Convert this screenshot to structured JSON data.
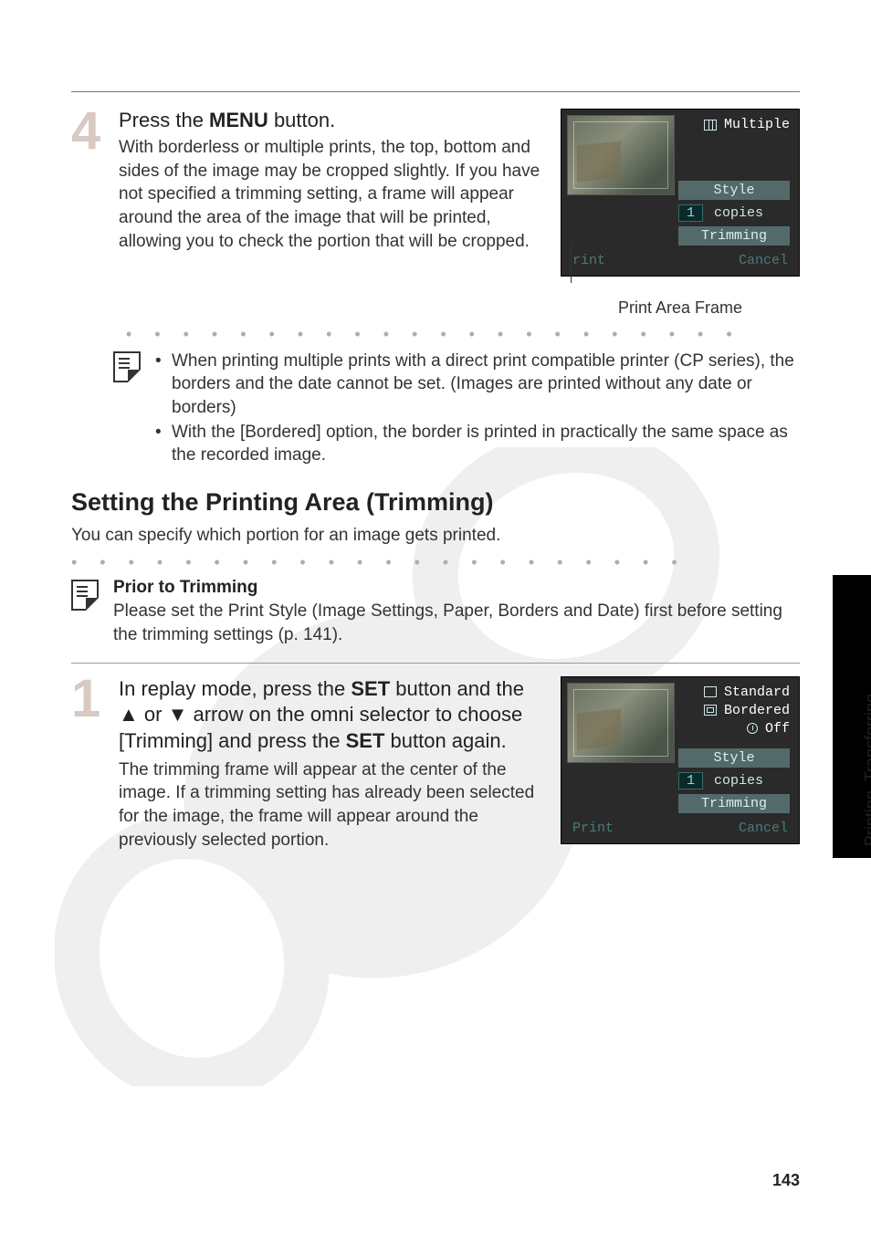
{
  "step4": {
    "number": "4",
    "heading_prefix": "Press the ",
    "heading_bold": "MENU",
    "heading_suffix": " button.",
    "desc": "With borderless or multiple prints, the top, bottom and sides of the image may be cropped slightly. If you have not specified a trimming setting, a frame will appear around the area of the image that will be printed, allowing you to check the portion that will be cropped.",
    "screen": {
      "mode_label": "Multiple",
      "style_label": "Style",
      "copies_value": "1",
      "copies_label": "copies",
      "trimming_label": "Trimming",
      "print_label": "rint",
      "cancel_label": "Cancel"
    },
    "caption": "Print Area Frame"
  },
  "notes1": {
    "b1": "When printing multiple prints with a direct print compatible printer (CP series), the borders and the date cannot be set. (Images are printed without any date or borders)",
    "b2": "With the [Bordered] option, the border is printed in practically the same space as the recorded image."
  },
  "section_title": "Setting the Printing Area (Trimming)",
  "section_intro": "You can specify which portion for an image gets printed.",
  "prior": {
    "title": "Prior to Trimming",
    "body": "Please set the Print Style (Image Settings, Paper, Borders and Date) first before setting the trimming settings (p. 141)."
  },
  "step1": {
    "number": "1",
    "h_part1": "In replay mode, press the ",
    "h_bold1": "SET",
    "h_part2": " button and the ",
    "h_up": "▲",
    "h_or": " or ",
    "h_down": "▼",
    "h_part3": " arrow on the omni selector to choose [Trimming] and press the ",
    "h_bold2": "SET",
    "h_part4": " button again.",
    "desc": "The trimming frame will appear at the center of the image. If a trimming setting has already been selected for the image, the frame will appear around the previously selected portion.",
    "screen": {
      "standard": "Standard",
      "bordered": "Bordered",
      "off": "Off",
      "style_label": "Style",
      "copies_value": "1",
      "copies_label": "copies",
      "trimming_label": "Trimming",
      "print_label": "Print",
      "cancel_label": "Cancel"
    }
  },
  "side_tab": "Printing, Transferring",
  "page_number": "143",
  "dots": "•  •  •  •  •  •  •  •  •  •  •  •  •  •  •  •  •  •  •  •  •  •"
}
